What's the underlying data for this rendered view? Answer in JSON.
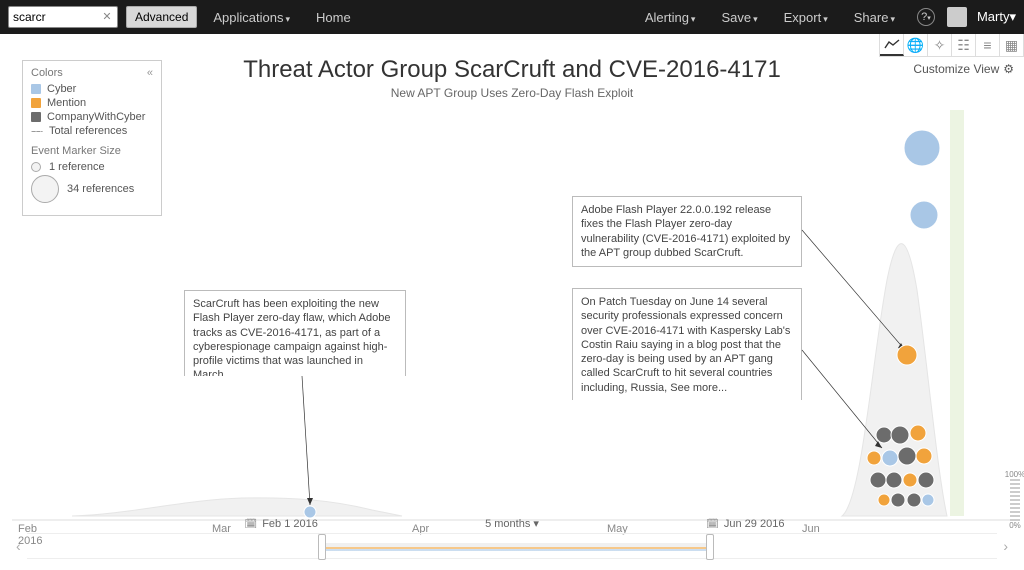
{
  "search": {
    "value": "scarcr",
    "placeholder": ""
  },
  "buttons": {
    "advanced": "Advanced"
  },
  "nav": {
    "applications": "Applications",
    "home": "Home",
    "alerting": "Alerting",
    "save": "Save",
    "export": "Export",
    "share": "Share"
  },
  "user": {
    "name": "Marty"
  },
  "customize": "Customize View",
  "title": "Threat Actor Group ScarCruft and CVE-2016-4171",
  "subtitle": "New APT Group Uses Zero-Day Flash Exploit",
  "legend": {
    "heading": "Colors",
    "items": [
      {
        "key": "cyber",
        "label": "Cyber"
      },
      {
        "key": "mention",
        "label": "Mention"
      },
      {
        "key": "companywithcyber",
        "label": "CompanyWithCyber"
      }
    ],
    "total_refs": "Total references",
    "size_heading": "Event Marker Size",
    "size_min": "1 reference",
    "size_max": "34 references"
  },
  "axis": {
    "feb": "Feb",
    "year": "2016",
    "mar": "Mar",
    "apr": "Apr",
    "may": "May",
    "jun": "Jun"
  },
  "callouts": {
    "c1": "ScarCruft has been exploiting the new Flash Player zero-day flaw, which Adobe tracks as CVE-2016-4171, as part of a cyberespionage campaign against high-profile victims that was launched in March.",
    "c2": "Adobe Flash Player 22.0.0.192 release fixes the Flash Player zero-day vulnerability (CVE-2016-4171) exploited by the APT group dubbed ScarCruft.",
    "c3": "On Patch Tuesday on June 14 several security professionals expressed concern over CVE-2016-4171 with Kaspersky Lab's Costin Raiu saying in a blog post that the zero-day is being used by an APT gang called ScarCruft to hit several countries including,  Russia,   See more..."
  },
  "range": {
    "from": "Feb 1 2016",
    "to": "Jun 29 2016",
    "span": "5 months",
    "pct_top": "100%",
    "pct_bot": "0%"
  },
  "chart_data": {
    "type": "timeline-bubble",
    "x_axis": {
      "ticks": [
        "Feb 2016",
        "Mar",
        "Apr",
        "May",
        "Jun"
      ],
      "range": [
        "2016-02-01",
        "2016-06-29"
      ]
    },
    "density_area": [
      {
        "x": "2016-02-01",
        "y": 0
      },
      {
        "x": "2016-02-15",
        "y": 2
      },
      {
        "x": "2016-03-01",
        "y": 6
      },
      {
        "x": "2016-03-15",
        "y": 8
      },
      {
        "x": "2016-04-01",
        "y": 5
      },
      {
        "x": "2016-04-15",
        "y": 0
      },
      {
        "x": "2016-06-05",
        "y": 0
      },
      {
        "x": "2016-06-14",
        "y": 45
      },
      {
        "x": "2016-06-17",
        "y": 95
      },
      {
        "x": "2016-06-20",
        "y": 60
      },
      {
        "x": "2016-06-29",
        "y": 10
      }
    ],
    "events": [
      {
        "date": "2016-03-03",
        "category": "cyber",
        "refs": 1,
        "callout": "c1"
      },
      {
        "date": "2016-06-14",
        "category": "mention",
        "refs": 6
      },
      {
        "date": "2016-06-14",
        "category": "companywithcyber",
        "refs": 4
      },
      {
        "date": "2016-06-15",
        "category": "cyber",
        "refs": 3
      },
      {
        "date": "2016-06-15",
        "category": "companywithcyber",
        "refs": 5
      },
      {
        "date": "2016-06-16",
        "category": "mention",
        "refs": 8,
        "callout": "c2"
      },
      {
        "date": "2016-06-16",
        "category": "companywithcyber",
        "refs": 7,
        "callout": "c3"
      },
      {
        "date": "2016-06-16",
        "category": "mention",
        "refs": 3
      },
      {
        "date": "2016-06-17",
        "category": "companywithcyber",
        "refs": 5
      },
      {
        "date": "2016-06-17",
        "category": "mention",
        "refs": 9
      },
      {
        "date": "2016-06-17",
        "category": "cyber",
        "refs": 2
      },
      {
        "date": "2016-06-18",
        "category": "companywithcyber",
        "refs": 4
      },
      {
        "date": "2016-06-18",
        "category": "mention",
        "refs": 3
      },
      {
        "date": "2016-06-18",
        "category": "companywithcyber",
        "refs": 6
      },
      {
        "date": "2016-06-20",
        "category": "cyber",
        "refs": 34
      },
      {
        "date": "2016-06-22",
        "category": "cyber",
        "refs": 20
      },
      {
        "date": "2016-06-24",
        "category": "mention",
        "refs": 12
      }
    ],
    "colors": {
      "cyber": "#a9c7e6",
      "mention": "#f1a33c",
      "companywithcyber": "#6c6c6c"
    }
  }
}
